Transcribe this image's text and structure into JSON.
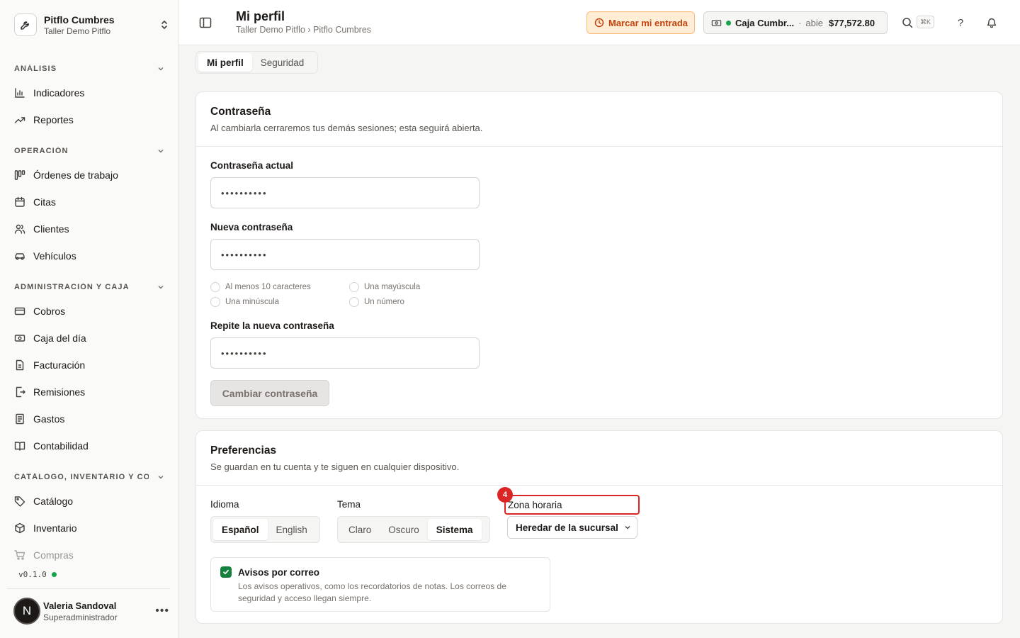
{
  "workspace": {
    "name": "Pitflo Cumbres",
    "subtitle": "Taller Demo Pitflo"
  },
  "sidebar": {
    "sections": [
      {
        "label": "ANÁLISIS",
        "items": [
          {
            "label": "Indicadores",
            "icon": "bar-chart-icon"
          },
          {
            "label": "Reportes",
            "icon": "trend-icon"
          }
        ]
      },
      {
        "label": "OPERACIÓN",
        "items": [
          {
            "label": "Órdenes de trabajo",
            "icon": "kanban-icon"
          },
          {
            "label": "Citas",
            "icon": "calendar-icon"
          },
          {
            "label": "Clientes",
            "icon": "users-icon"
          },
          {
            "label": "Vehículos",
            "icon": "car-icon"
          }
        ]
      },
      {
        "label": "ADMINISTRACIÓN Y CAJA",
        "items": [
          {
            "label": "Cobros",
            "icon": "credit-card-icon"
          },
          {
            "label": "Caja del día",
            "icon": "banknote-icon"
          },
          {
            "label": "Facturación",
            "icon": "file-icon"
          },
          {
            "label": "Remisiones",
            "icon": "file-export-icon"
          },
          {
            "label": "Gastos",
            "icon": "receipt-icon"
          },
          {
            "label": "Contabilidad",
            "icon": "book-icon"
          }
        ]
      },
      {
        "label": "CATÁLOGO, INVENTARIO Y CO...",
        "items": [
          {
            "label": "Catálogo",
            "icon": "tag-icon"
          },
          {
            "label": "Inventario",
            "icon": "box-icon"
          },
          {
            "label": "Compras",
            "icon": "cart-icon"
          }
        ]
      }
    ],
    "version": "v0.1.0",
    "user": {
      "initial": "N",
      "name": "Valeria Sandoval",
      "role": "Superadministrador"
    }
  },
  "header": {
    "title": "Mi perfil",
    "breadcrumb": "Taller Demo Pitflo › Pitflo Cumbres",
    "clock_in_label": "Marcar mi entrada",
    "cash": {
      "name": "Caja Cumbr...",
      "separator": "·",
      "status": "abie",
      "amount": "$77,572.80"
    },
    "shortcut": "⌘K",
    "help": "?"
  },
  "tabs": [
    {
      "label": "Mi perfil"
    },
    {
      "label": "Seguridad"
    }
  ],
  "password": {
    "title": "Contraseña",
    "description": "Al cambiarla cerraremos tus demás sesiones; esta seguirá abierta.",
    "current_label": "Contraseña actual",
    "current_value": "••••••••••",
    "new_label": "Nueva contraseña",
    "new_value": "••••••••••",
    "requirements": [
      "Al menos 10 caracteres",
      "Una mayúscula",
      "Una minúscula",
      "Un número"
    ],
    "repeat_label": "Repite la nueva contraseña",
    "repeat_value": "••••••••••",
    "submit_label": "Cambiar contraseña"
  },
  "preferences": {
    "title": "Preferencias",
    "description": "Se guardan en tu cuenta y te siguen en cualquier dispositivo.",
    "language_label": "Idioma",
    "languages": [
      "Español",
      "English"
    ],
    "theme_label": "Tema",
    "themes": [
      "Claro",
      "Oscuro",
      "Sistema"
    ],
    "timezone_label": "Zona horaria",
    "timezone_badge": "4",
    "timezone_value": "Heredar de la sucursal",
    "email_title": "Avisos por correo",
    "email_desc": "Los avisos operativos, como los recordatorios de notas. Los correos de seguridad y acceso llegan siempre."
  },
  "colors": {
    "accent_orange": "#c2410c",
    "success": "#16a34a",
    "highlight": "#dc2626"
  }
}
